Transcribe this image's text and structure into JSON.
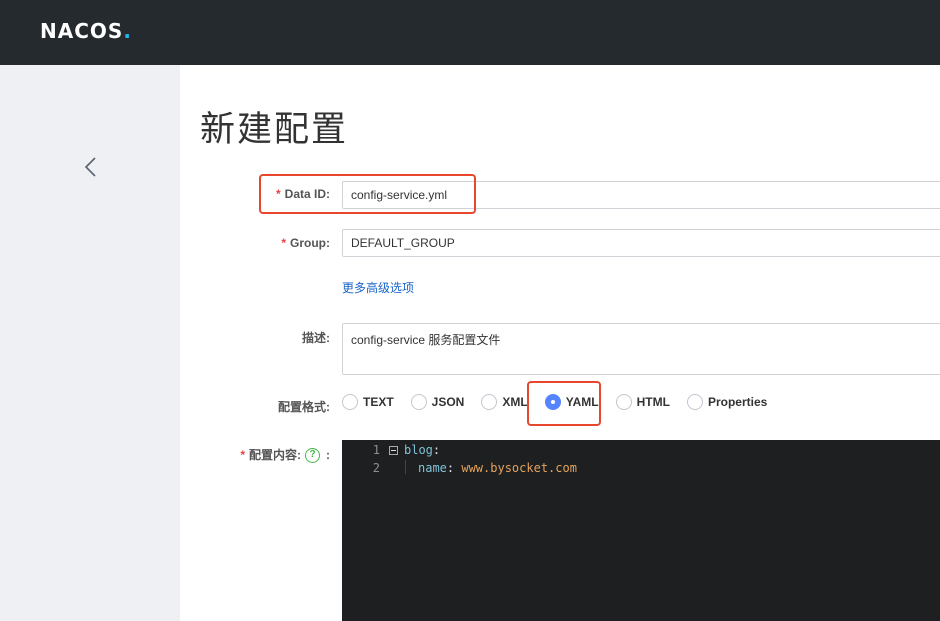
{
  "header": {
    "logo_text": "NACOS",
    "brand_color": "#252a2f",
    "accent": "#2cb6ea"
  },
  "sidebar": {
    "back_icon": "chevron-left-icon"
  },
  "page": {
    "title": "新建配置"
  },
  "form": {
    "data_id": {
      "required": "*",
      "label": "Data ID:",
      "value": "config-service.yml"
    },
    "group": {
      "required": "*",
      "label": "Group:",
      "value": "DEFAULT_GROUP"
    },
    "advanced_link": "更多高级选项",
    "description": {
      "label": "描述:",
      "value": "config-service 服务配置文件"
    },
    "format": {
      "label": "配置格式:",
      "options": [
        "TEXT",
        "JSON",
        "XML",
        "YAML",
        "HTML",
        "Properties"
      ],
      "selected": "YAML"
    },
    "content": {
      "required": "*",
      "label": "配置内容:",
      "help": "?",
      "colon": ":"
    }
  },
  "editor": {
    "lines": [
      {
        "number": "1",
        "key": "blog",
        "sep": ":",
        "value": ""
      },
      {
        "number": "2",
        "key": "name",
        "sep": ": ",
        "value": "www.bysocket.com"
      }
    ]
  },
  "highlight_color": "#e8472e"
}
